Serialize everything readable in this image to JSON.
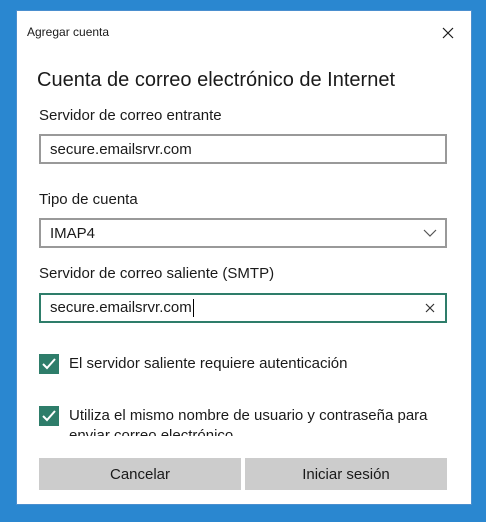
{
  "window": {
    "title": "Agregar cuenta"
  },
  "heading": "Cuenta de correo electrónico de Internet",
  "incoming": {
    "label": "Servidor de correo entrante",
    "value": "secure.emailsrvr.com"
  },
  "account_type": {
    "label": "Tipo de cuenta",
    "selected": "IMAP4"
  },
  "outgoing": {
    "label": "Servidor de correo saliente (SMTP)",
    "value": "secure.emailsrvr.com"
  },
  "checkboxes": [
    {
      "label": "El servidor saliente requiere autenticación",
      "checked": true
    },
    {
      "label": "Utiliza el mismo nombre de usuario y contraseña para enviar correo electrónico",
      "checked": true
    }
  ],
  "buttons": {
    "cancel": "Cancelar",
    "signin": "Iniciar sesión"
  },
  "colors": {
    "accent": "#2e7d6a",
    "desktop": "#2a87d0",
    "button": "#cccccc"
  }
}
